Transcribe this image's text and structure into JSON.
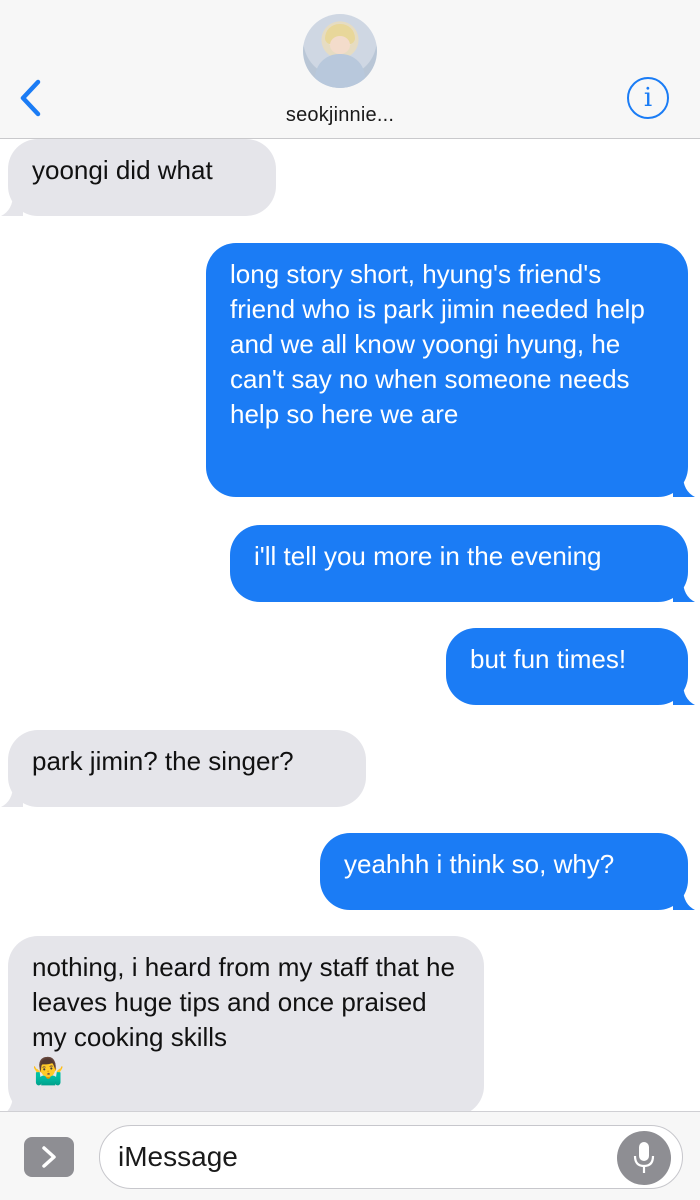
{
  "header": {
    "contact_name": "seokjinnie...",
    "info_glyph": "i",
    "back_icon": "chevron-left-icon",
    "accent_color": "#1b7cf5"
  },
  "messages": [
    {
      "direction": "received",
      "text": "yoongi did what"
    },
    {
      "direction": "sent",
      "text": "long story short, hyung's friend's friend who is park jimin needed help and we all know yoongi hyung, he can't say no when someone needs help so here we are"
    },
    {
      "direction": "sent",
      "text": "i'll tell you more in the evening"
    },
    {
      "direction": "sent",
      "text": "but fun times!"
    },
    {
      "direction": "received",
      "text": "park jimin? the singer?"
    },
    {
      "direction": "sent",
      "text": "yeahhh i think so, why?"
    },
    {
      "direction": "received",
      "text": "nothing, i heard from my staff that he leaves huge tips and once praised my cooking skills",
      "emoji": "🤷‍♂️"
    }
  ],
  "input": {
    "placeholder": "iMessage",
    "expand_icon": "chevron-right-icon",
    "mic_icon": "microphone-icon"
  },
  "colors": {
    "received_bubble": "#e5e5ea",
    "sent_bubble": "#1b7cf5"
  }
}
